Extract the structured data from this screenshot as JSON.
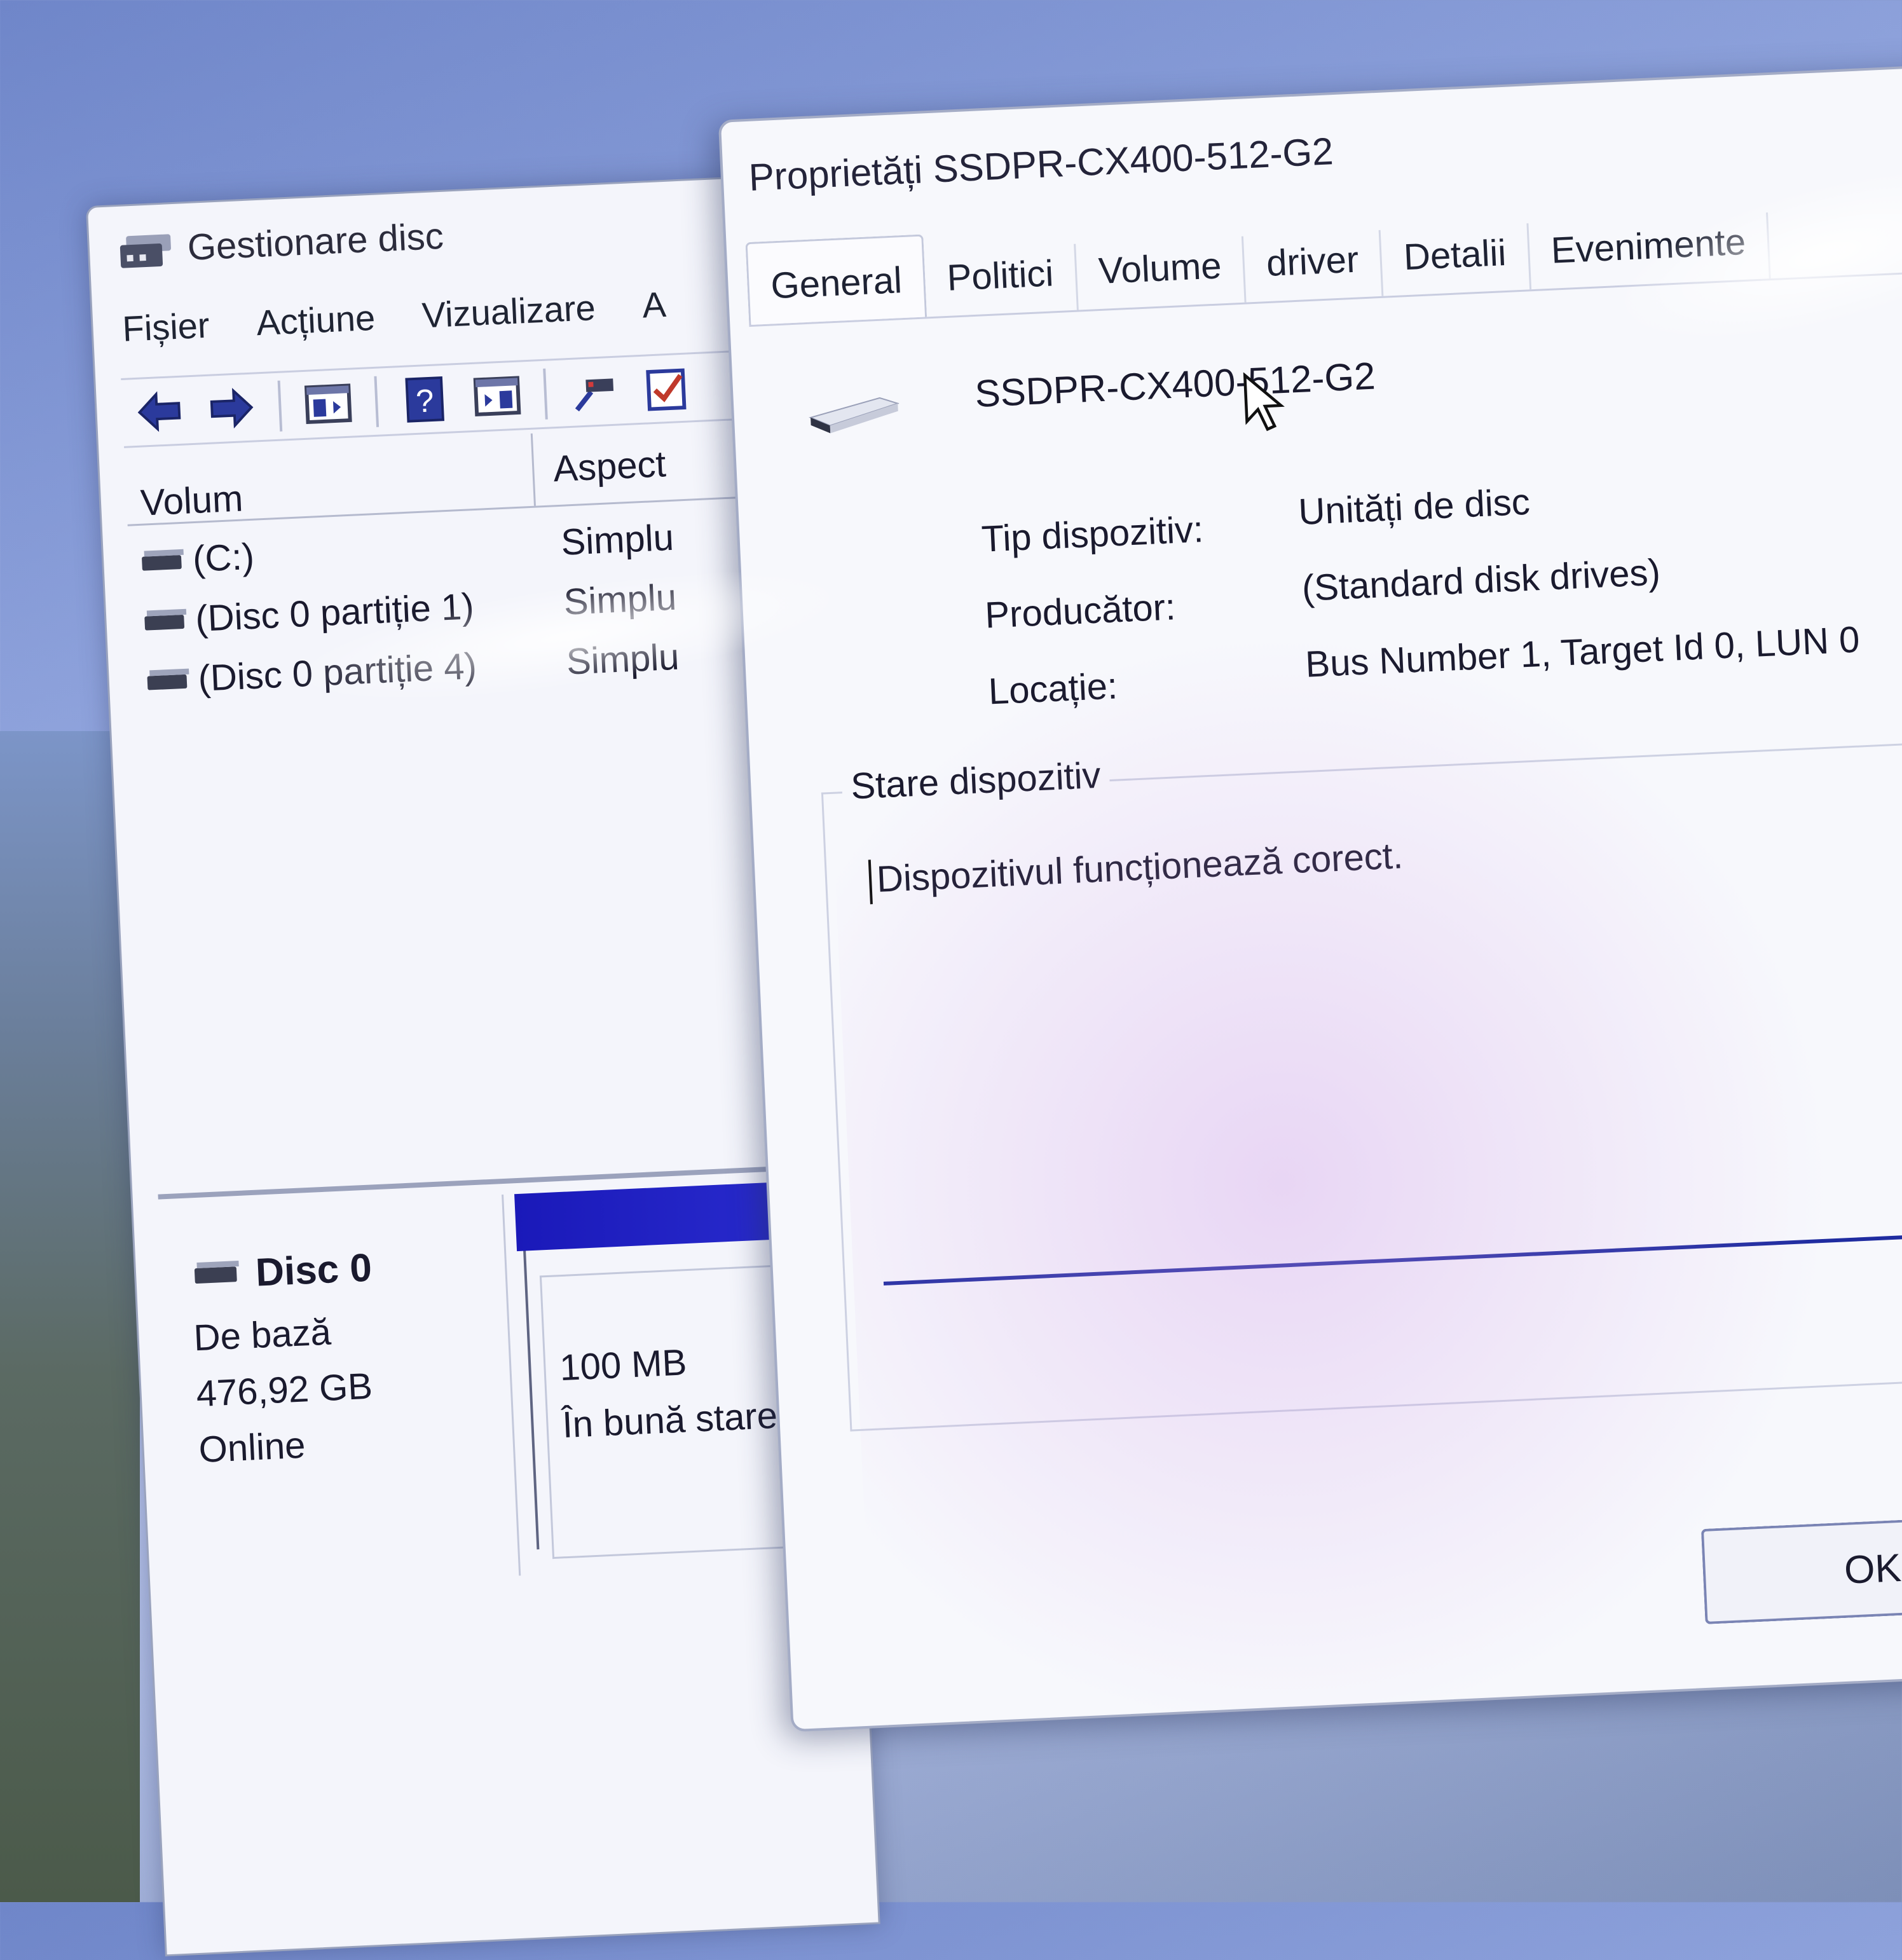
{
  "disk_management": {
    "title": "Gestionare disc",
    "menu": [
      "Fișier",
      "Acțiune",
      "Vizualizare",
      "A"
    ],
    "columns": {
      "volume": "Volum",
      "layout": "Aspect"
    },
    "volumes": [
      {
        "name": "(C:)",
        "layout": "Simplu"
      },
      {
        "name": "(Disc 0 partiție 1)",
        "layout": "Simplu"
      },
      {
        "name": "(Disc 0 partiție 4)",
        "layout": "Simplu"
      }
    ],
    "disk": {
      "name": "Disc 0",
      "type": "De bază",
      "size": "476,92 GB",
      "status": "Online",
      "partition": {
        "size": "100 MB",
        "health": "În bună stare"
      }
    }
  },
  "properties_dialog": {
    "title": "Proprietăți SSDPR-CX400-512-G2",
    "tabs": [
      "General",
      "Politici",
      "Volume",
      "driver",
      "Detalii",
      "Evenimente"
    ],
    "active_tab": "General",
    "device_name": "SSDPR-CX400-512-G2",
    "fields": {
      "device_type_label": "Tip dispozitiv:",
      "device_type_value": "Unități de disc",
      "manufacturer_label": "Producător:",
      "manufacturer_value": "(Standard disk drives)",
      "location_label": "Locație:",
      "location_value": "Bus Number 1, Target Id 0, LUN 0"
    },
    "status": {
      "legend": "Stare dispozitiv",
      "text": "Dispozitivul funcționează corect."
    },
    "ok_label": "OK"
  },
  "colors": {
    "partition_bar": "#1a19b9",
    "status_line": "#1f2ca0",
    "window_bg": "#f4f5fb"
  }
}
